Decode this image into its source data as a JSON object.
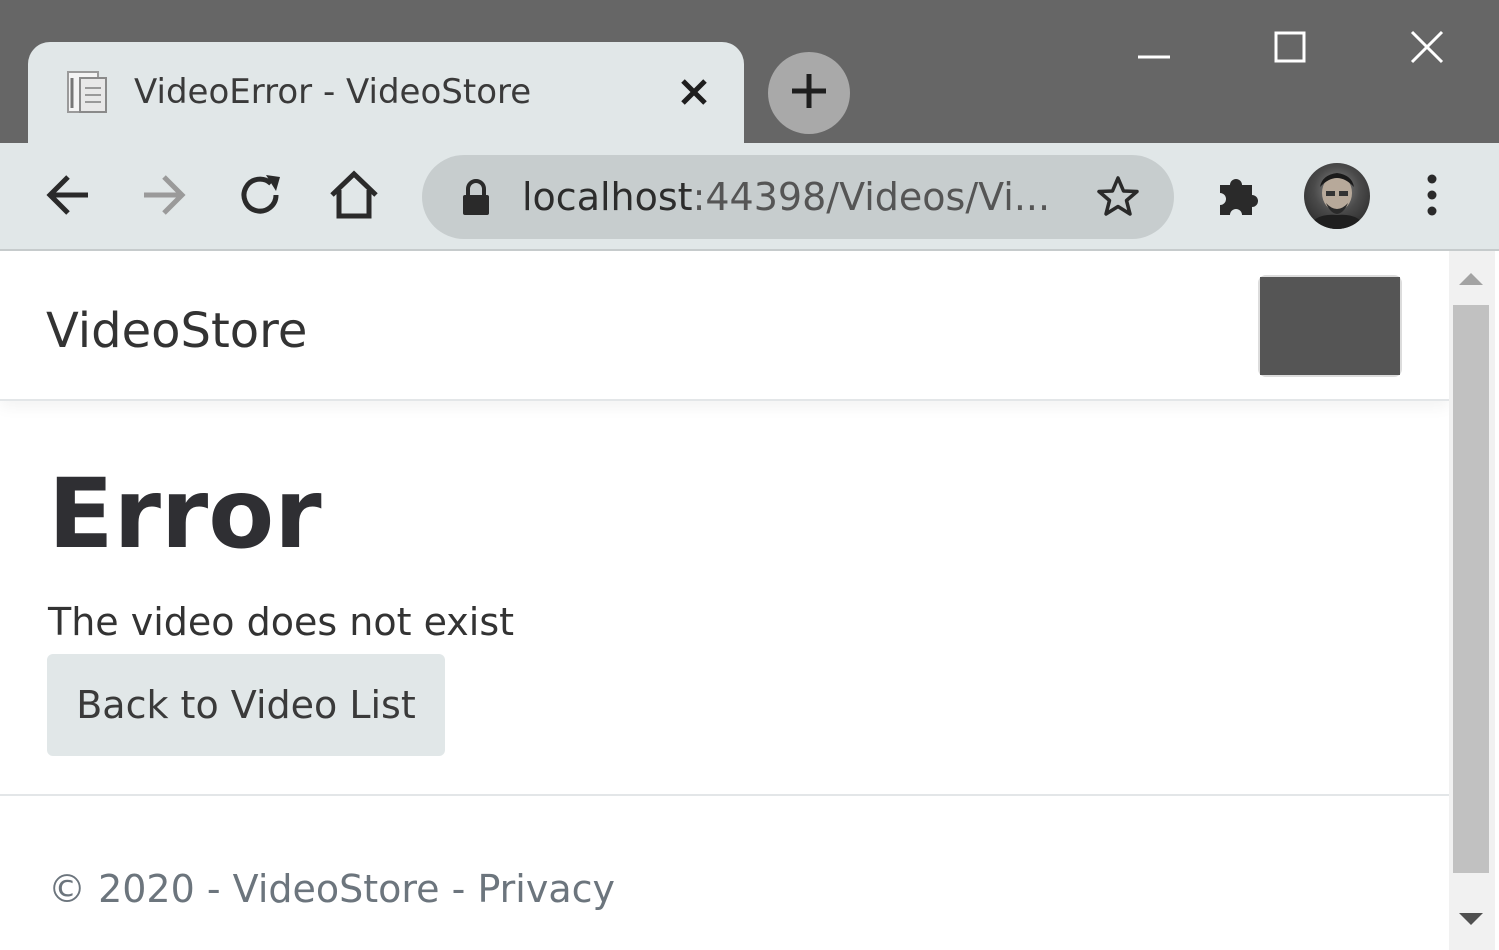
{
  "browser": {
    "tab": {
      "title": "VideoError - VideoStore",
      "favicon": "page-icon"
    },
    "address_bar": {
      "url_host": "localhost",
      "url_rest": ":44398/Videos/Vi..."
    },
    "icons": {
      "back": "back-arrow-icon",
      "forward": "forward-arrow-icon",
      "reload": "reload-icon",
      "home": "home-icon",
      "lock": "lock-icon",
      "bookmark": "star-icon",
      "extensions": "puzzle-icon",
      "menu": "kebab-menu-icon",
      "minimize": "minimize-icon",
      "maximize": "maximize-icon",
      "close": "close-icon",
      "new_tab": "plus-icon"
    },
    "colors": {
      "titlebar": "#666666",
      "toolbar": "#e1e7e8",
      "omnibox": "#c7cdce"
    }
  },
  "page": {
    "navbar": {
      "brand": "VideoStore",
      "toggler_icon": "hamburger-icon"
    },
    "main": {
      "heading": "Error",
      "message": "The video does not exist",
      "back_button_label": "Back to Video List"
    },
    "footer": {
      "prefix": "© 2020 - VideoStore - ",
      "privacy_link": "Privacy"
    },
    "colors": {
      "button_bg": "#e1e7e8",
      "footer_text": "#6c757d",
      "heading_text": "#2f2f33"
    }
  }
}
